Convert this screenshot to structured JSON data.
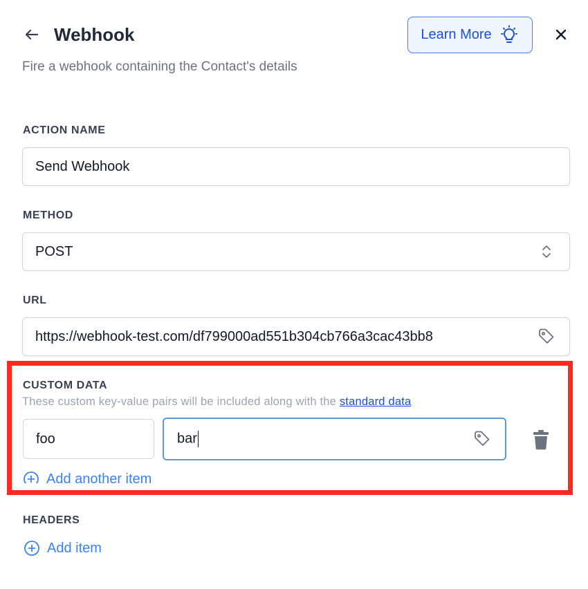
{
  "header": {
    "title": "Webhook",
    "subtitle": "Fire a webhook containing the Contact's details",
    "learn_more_label": "Learn More"
  },
  "action_name": {
    "label": "ACTION NAME",
    "value": "Send Webhook"
  },
  "method": {
    "label": "METHOD",
    "selected": "POST"
  },
  "url": {
    "label": "URL",
    "value": "https://webhook-test.com/df799000ad551b304cb766a3cac43bb8"
  },
  "custom_data": {
    "label": "CUSTOM DATA",
    "description": "These custom key-value pairs will be included along with the ",
    "description_link": "standard data",
    "items": [
      {
        "key": "foo",
        "value": "bar"
      }
    ],
    "add_label": "Add another item"
  },
  "headers": {
    "label": "HEADERS",
    "add_label": "Add item"
  },
  "colors": {
    "accent": "#3b82f6",
    "highlight_frame": "#ff2a1f",
    "link": "#1d4ed8"
  },
  "icons": [
    "back-arrow-icon",
    "lightbulb-icon",
    "close-icon",
    "chevron-updown-icon",
    "tag-icon",
    "trash-icon",
    "plus-circle-icon"
  ]
}
